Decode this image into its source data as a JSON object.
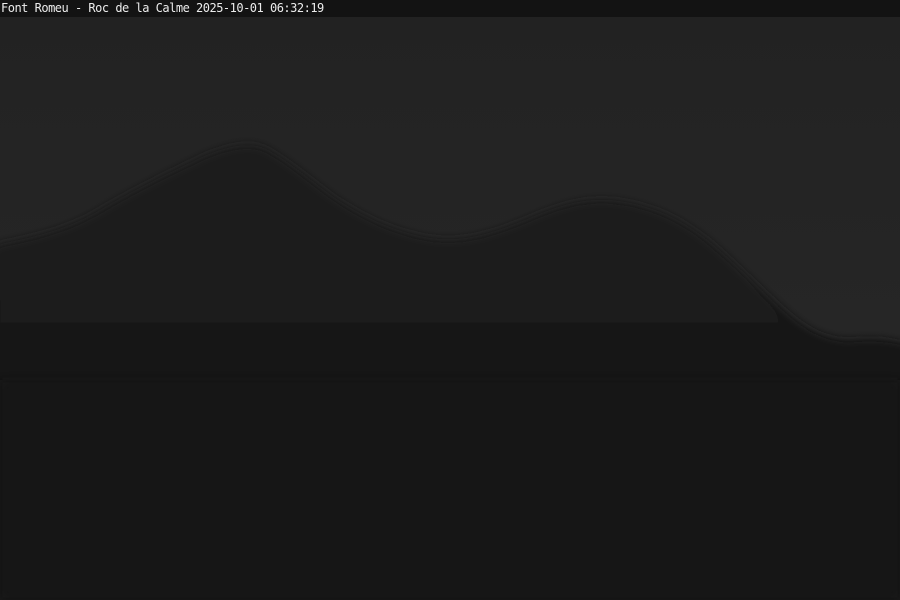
{
  "overlay": {
    "caption": "Font Romeu - Roc de la Calme 2025-10-01 06:32:19"
  },
  "scene": {
    "sky_color": "#252525",
    "mountain_color": "#1b1b1b",
    "foreground_color": "#161616"
  }
}
